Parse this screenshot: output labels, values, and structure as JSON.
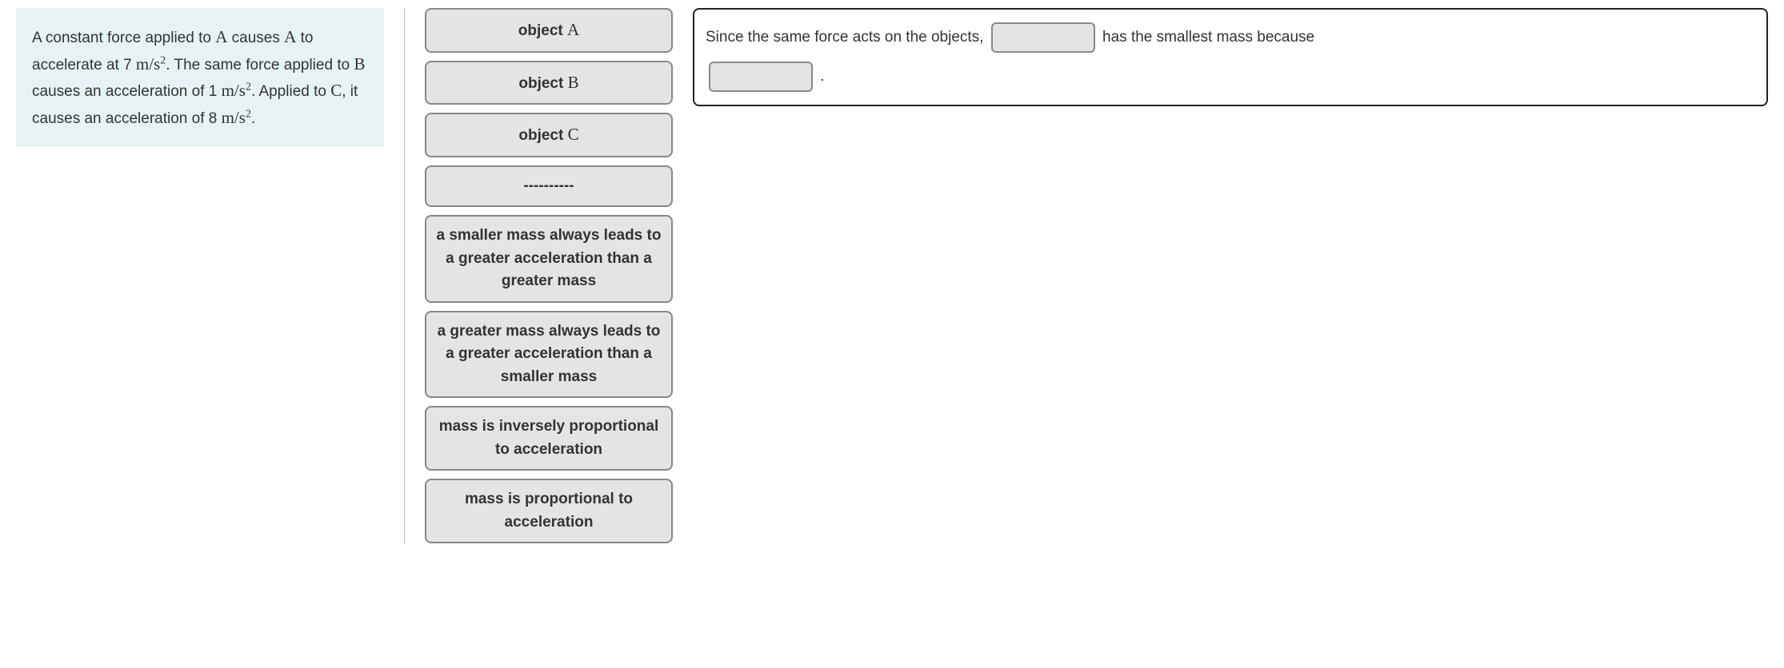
{
  "prompt": {
    "part1": "A constant force applied to ",
    "varA1": "A",
    "part2": " causes ",
    "varA2": "A",
    "part3": " to accelerate at 7 ",
    "unit1_base": "m/s",
    "unit1_exp": "2",
    "part4": ". The same force applied to ",
    "varB": "B",
    "part5": " causes an acceleration of 1 ",
    "unit2_base": "m/s",
    "unit2_exp": "2",
    "part6": ". Applied to ",
    "varC": "C",
    "part7": ", it causes an acceleration of 8 ",
    "unit3_base": "m/s",
    "unit3_exp": "2",
    "part8": "."
  },
  "tiles": [
    {
      "prefix": "object ",
      "var": "A"
    },
    {
      "prefix": "object ",
      "var": "B"
    },
    {
      "prefix": "object ",
      "var": "C"
    },
    {
      "label": "----------"
    },
    {
      "label": "a smaller mass always leads to a greater acceleration than a greater mass"
    },
    {
      "label": "a greater mass always leads to a greater acceleration than a smaller mass"
    },
    {
      "label": "mass is inversely proportional to acceleration"
    },
    {
      "label": "mass is proportional to acceleration"
    }
  ],
  "sentence": {
    "s1": "Since the same force acts on the objects, ",
    "s2": " has the smallest mass because ",
    "s3": " ."
  }
}
